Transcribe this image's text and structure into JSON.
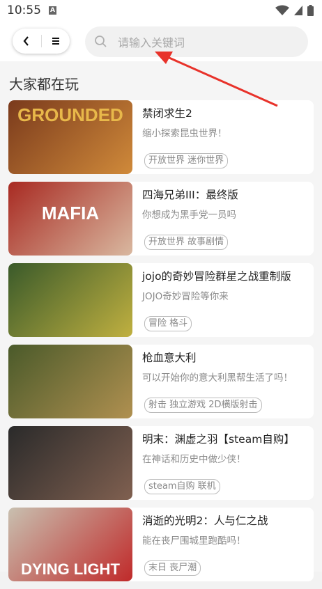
{
  "status_bar": {
    "time": "10:55",
    "notification_icon": "A"
  },
  "header": {
    "search": {
      "placeholder": "请输入关键词"
    }
  },
  "section": {
    "title": "大家都在玩"
  },
  "games": [
    {
      "title": "禁闭求生2",
      "desc": "缩小探索昆虫世界！",
      "tags": "开放世界 迷你世界",
      "thumb_text": "GROUNDED",
      "thumb_colors": [
        "#7a3a1c",
        "#d08a3a"
      ]
    },
    {
      "title": "四海兄弟III：最终版",
      "desc": "你想成为黑手党一员吗",
      "tags": "开放世界 故事剧情",
      "thumb_text": "MAFIA",
      "thumb_colors": [
        "#a82a22",
        "#d9b8a0"
      ]
    },
    {
      "title": "jojo的奇妙冒险群星之战重制版",
      "desc": "JOJO奇妙冒险等你来",
      "tags": "冒险 格斗",
      "thumb_text": "",
      "thumb_colors": [
        "#3a5a2a",
        "#c0b040"
      ]
    },
    {
      "title": "枪血意大利",
      "desc": "可以开始你的意大利黑帮生活了吗！",
      "tags": "射击 独立游戏 2D横版射击",
      "thumb_text": "",
      "thumb_colors": [
        "#4a5a2a",
        "#b09050"
      ]
    },
    {
      "title": "明末：渊虚之羽【steam自购】",
      "desc": "在神话和历史中做少侠！",
      "tags": "steam自购 联机",
      "thumb_text": "",
      "thumb_colors": [
        "#2a2a2a",
        "#806050"
      ]
    },
    {
      "title": "消逝的光明2：人与仁之战",
      "desc": "能在丧尸围城里跑酷吗！",
      "tags": "末日 丧尸潮",
      "thumb_text": "DYING LIGHT",
      "thumb_colors": [
        "#c8c0b0",
        "#c02a2a"
      ]
    }
  ],
  "icons": {
    "back": "chevron-left-icon",
    "menu": "menu-icon",
    "search": "search-icon",
    "wifi": "wifi-icon",
    "signal": "signal-icon",
    "battery": "battery-icon"
  },
  "colors": {
    "annotation_arrow": "#e8322a"
  }
}
